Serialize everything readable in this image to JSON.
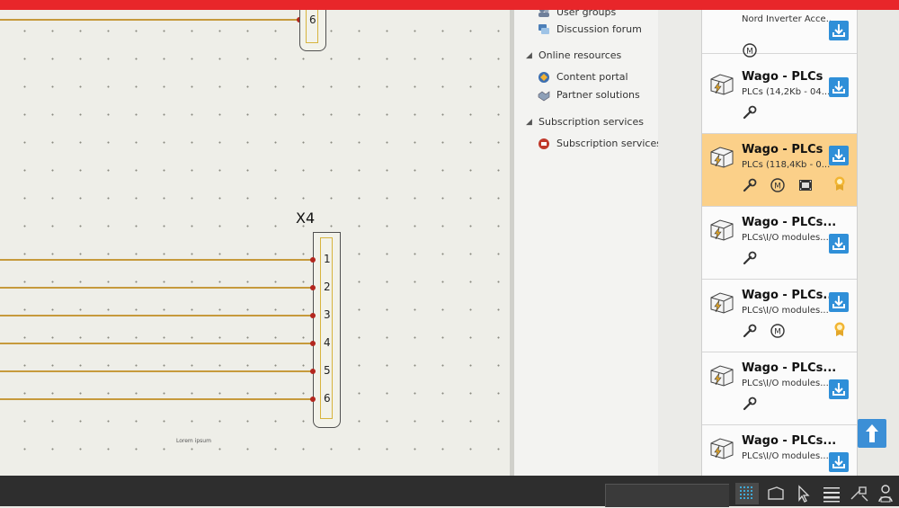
{
  "canvas": {
    "top_terminal_pin": "6",
    "terminal_title": "X4",
    "pins": [
      "1",
      "2",
      "3",
      "4",
      "5",
      "6"
    ],
    "footer_text": "Lorem ipsum"
  },
  "tree": {
    "items": [
      {
        "type": "item",
        "label": "User groups",
        "icon": "user-groups-icon"
      },
      {
        "type": "item",
        "label": "Discussion forum",
        "icon": "forum-icon"
      },
      {
        "type": "header",
        "label": "Online resources"
      },
      {
        "type": "item",
        "label": "Content portal",
        "icon": "content-portal-icon"
      },
      {
        "type": "item",
        "label": "Partner solutions",
        "icon": "partner-icon"
      },
      {
        "type": "header",
        "label": "Subscription services"
      },
      {
        "type": "item",
        "label": "Subscription services",
        "icon": "subscription-icon"
      }
    ]
  },
  "cards": [
    {
      "title": "",
      "subtitle": "Nord Inverter Acce...",
      "features": [
        "macro-icon"
      ],
      "selected": false
    },
    {
      "title": "Wago - PLCs",
      "subtitle": "PLCs (14,2Kb - 04...",
      "features": [
        "wrench-icon"
      ],
      "selected": false
    },
    {
      "title": "Wago - PLCs",
      "subtitle": "PLCs (118,4Kb - 0...",
      "features": [
        "wrench-icon",
        "macro-icon",
        "film-icon",
        "award-icon"
      ],
      "selected": true
    },
    {
      "title": "Wago - PLCs...",
      "subtitle": "PLCs\\I/O modules...",
      "features": [
        "wrench-icon"
      ],
      "selected": false
    },
    {
      "title": "Wago - PLCs...",
      "subtitle": "PLCs\\I/O modules...",
      "features": [
        "wrench-icon",
        "macro-icon",
        "award-icon"
      ],
      "selected": false
    },
    {
      "title": "Wago - PLCs...",
      "subtitle": "PLCs\\I/O modules...",
      "features": [
        "wrench-icon"
      ],
      "selected": false
    },
    {
      "title": "Wago - PLCs...",
      "subtitle": "PLCs\\I/O modules...",
      "features": [],
      "selected": false
    }
  ],
  "colors": {
    "accent_red": "#e8262a",
    "selected_card": "#fbd089",
    "download_blue": "#2f8fd8",
    "wire": "#c69a3c"
  }
}
